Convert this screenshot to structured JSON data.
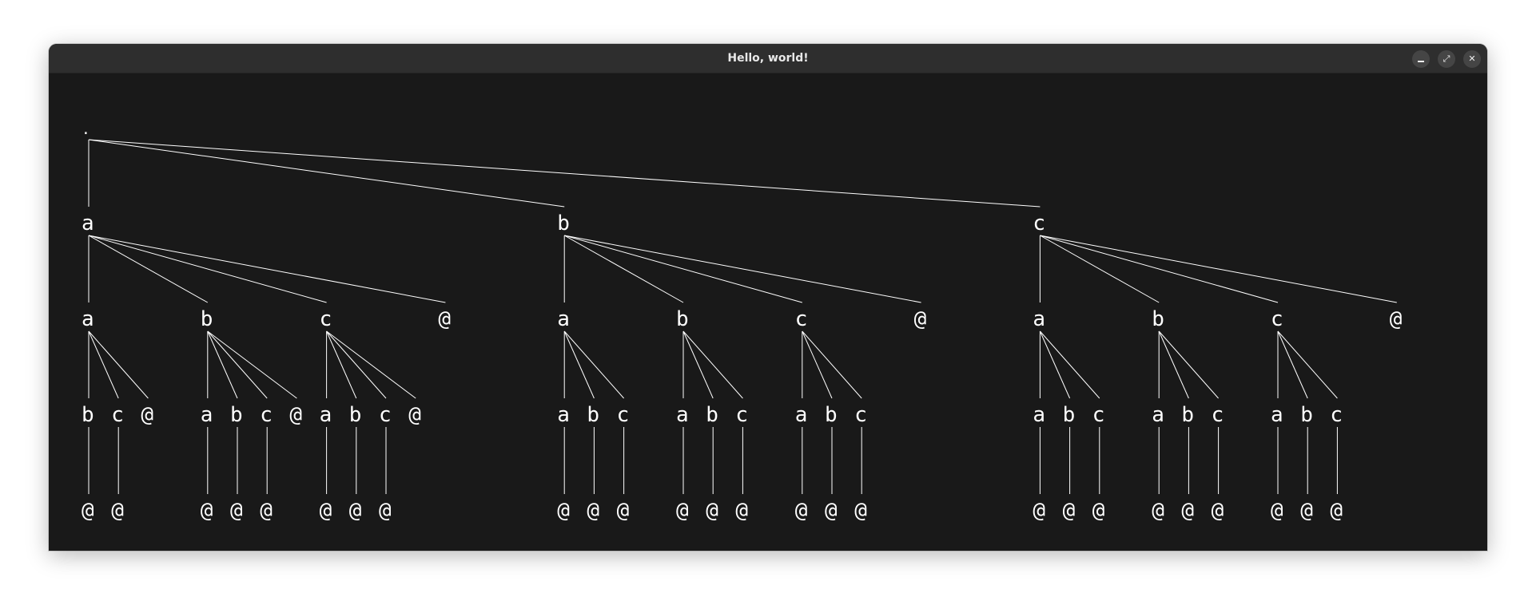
{
  "window": {
    "title": "Hello, world!",
    "controls": {
      "minimize_icon": "minimize-icon",
      "maximize_icon": "maximize-icon",
      "close_icon": "close-icon",
      "close_glyph": "✕",
      "maximize_glyph": "⤢"
    }
  },
  "tree": {
    "label": ".",
    "children": [
      {
        "label": "a",
        "children": [
          {
            "label": "a",
            "children": [
              {
                "label": "b",
                "children": [
                  {
                    "label": "@"
                  }
                ]
              },
              {
                "label": "c",
                "children": [
                  {
                    "label": "@"
                  }
                ]
              },
              {
                "label": "@"
              }
            ]
          },
          {
            "label": "b",
            "children": [
              {
                "label": "a",
                "children": [
                  {
                    "label": "@"
                  }
                ]
              },
              {
                "label": "b",
                "children": [
                  {
                    "label": "@"
                  }
                ]
              },
              {
                "label": "c",
                "children": [
                  {
                    "label": "@"
                  }
                ]
              },
              {
                "label": "@"
              }
            ]
          },
          {
            "label": "c",
            "children": [
              {
                "label": "a",
                "children": [
                  {
                    "label": "@"
                  }
                ]
              },
              {
                "label": "b",
                "children": [
                  {
                    "label": "@"
                  }
                ]
              },
              {
                "label": "c",
                "children": [
                  {
                    "label": "@"
                  }
                ]
              },
              {
                "label": "@"
              }
            ]
          },
          {
            "label": "@"
          }
        ]
      },
      {
        "label": "b",
        "children": [
          {
            "label": "a",
            "children": [
              {
                "label": "a",
                "children": [
                  {
                    "label": "@"
                  }
                ]
              },
              {
                "label": "b",
                "children": [
                  {
                    "label": "@"
                  }
                ]
              },
              {
                "label": "c",
                "children": [
                  {
                    "label": "@"
                  }
                ]
              }
            ]
          },
          {
            "label": "b",
            "children": [
              {
                "label": "a",
                "children": [
                  {
                    "label": "@"
                  }
                ]
              },
              {
                "label": "b",
                "children": [
                  {
                    "label": "@"
                  }
                ]
              },
              {
                "label": "c",
                "children": [
                  {
                    "label": "@"
                  }
                ]
              }
            ]
          },
          {
            "label": "c",
            "children": [
              {
                "label": "a",
                "children": [
                  {
                    "label": "@"
                  }
                ]
              },
              {
                "label": "b",
                "children": [
                  {
                    "label": "@"
                  }
                ]
              },
              {
                "label": "c",
                "children": [
                  {
                    "label": "@"
                  }
                ]
              }
            ]
          },
          {
            "label": "@"
          }
        ]
      },
      {
        "label": "c",
        "children": [
          {
            "label": "a",
            "children": [
              {
                "label": "a",
                "children": [
                  {
                    "label": "@"
                  }
                ]
              },
              {
                "label": "b",
                "children": [
                  {
                    "label": "@"
                  }
                ]
              },
              {
                "label": "c",
                "children": [
                  {
                    "label": "@"
                  }
                ]
              }
            ]
          },
          {
            "label": "b",
            "children": [
              {
                "label": "a",
                "children": [
                  {
                    "label": "@"
                  }
                ]
              },
              {
                "label": "b",
                "children": [
                  {
                    "label": "@"
                  }
                ]
              },
              {
                "label": "c",
                "children": [
                  {
                    "label": "@"
                  }
                ]
              }
            ]
          },
          {
            "label": "c",
            "children": [
              {
                "label": "a",
                "children": [
                  {
                    "label": "@"
                  }
                ]
              },
              {
                "label": "b",
                "children": [
                  {
                    "label": "@"
                  }
                ]
              },
              {
                "label": "c",
                "children": [
                  {
                    "label": "@"
                  }
                ]
              }
            ]
          },
          {
            "label": "@"
          }
        ]
      }
    ]
  }
}
